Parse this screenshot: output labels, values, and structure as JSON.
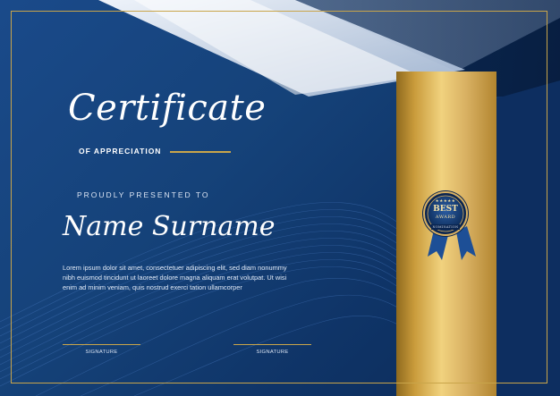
{
  "certificate": {
    "title": "Certificate",
    "subtitle": "OF APPRECIATION",
    "presented_label": "PROUDLY PRESENTED TO",
    "recipient_name": "Name Surname",
    "body_text": "Lorem ipsum dolor sit amet, consectetuer adipiscing elit, sed diam nonummy nibh euismod tincidunt ut laoreet dolore magna aliquam erat volutpat. Ut wisi enim ad minim veniam, quis nostrud exerci tation ullamcorper",
    "signatures": [
      {
        "label": "SIGNATURE"
      },
      {
        "label": "SIGNATURE"
      }
    ],
    "badge": {
      "stars": "★★★★★",
      "line1": "BEST",
      "line2": "AWARD",
      "caption": "NOMINATION"
    }
  },
  "colors": {
    "navy": "#154279",
    "gold": "#c9a54a",
    "white": "#ffffff"
  }
}
